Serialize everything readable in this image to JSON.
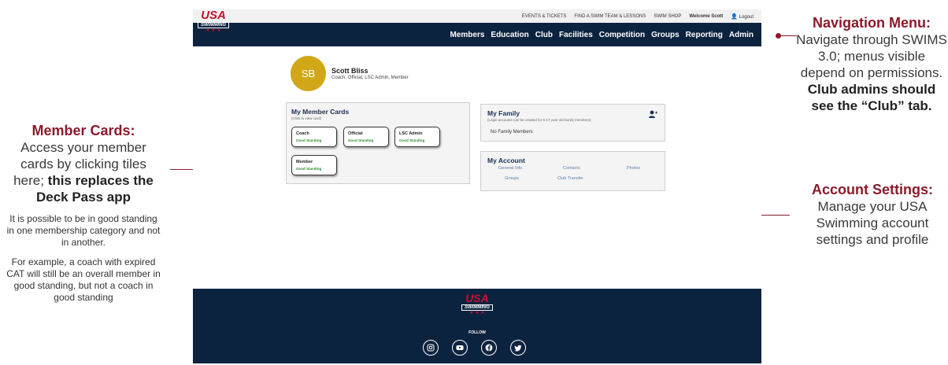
{
  "annotations": {
    "member_cards": {
      "title": "Member Cards:",
      "body_plain": "Access your member cards by clicking tiles here;",
      "body_bold": "this replaces the Deck Pass app",
      "note1": "It is possible to be in good standing in one membership category and not in another.",
      "note2": "For example, a coach with expired CAT will still be an overall member in good standing, but not a coach in good standing"
    },
    "navigation": {
      "title": "Navigation Menu:",
      "body_plain": "Navigate through SWIMS 3.0; menus visible depend on permissions.",
      "body_bold": "Club admins should see the “Club” tab."
    },
    "account": {
      "title": "Account Settings:",
      "body_plain": "Manage your USA Swimming account settings and profile"
    }
  },
  "logo": {
    "text": "USA",
    "subtext": "SWIMMING",
    "stars": "★ ★ ★"
  },
  "topbar": {
    "items": [
      "EVENTS & TICKETS",
      "FIND A SWIM TEAM & LESSONS",
      "SWIM SHOP"
    ],
    "welcome": "Welcome Scott",
    "logout": "Logout"
  },
  "nav": [
    "Members",
    "Education",
    "Club",
    "Facilities",
    "Competition",
    "Groups",
    "Reporting",
    "Admin"
  ],
  "profile": {
    "initials": "SB",
    "name": "Scott Bliss",
    "roles": "Coach, Official, LSC Admin, Member"
  },
  "member_cards": {
    "title": "My Member Cards",
    "subtitle": "(Click to view card)",
    "cards": [
      {
        "name": "Coach",
        "status": "Good Standing"
      },
      {
        "name": "Official",
        "status": "Good Standing"
      },
      {
        "name": "LSC Admin",
        "status": "Good Standing"
      },
      {
        "name": "Member",
        "status": "Good Standing"
      }
    ]
  },
  "family": {
    "title": "My Family",
    "subtitle": "(Login accounts can be created for 6-17 year old family members)",
    "empty": "No Family Members"
  },
  "account": {
    "title": "My Account",
    "links": [
      "General Info",
      "Contacts",
      "Photos",
      "Groups",
      "Club Transfer"
    ]
  },
  "footer": {
    "follow": "FOLLOW"
  },
  "colors": {
    "accent": "#8b1a2b",
    "navy": "#0c2340",
    "avatar": "#d1a718",
    "good_standing": "#2e8b2e",
    "link": "#5a7db3"
  }
}
